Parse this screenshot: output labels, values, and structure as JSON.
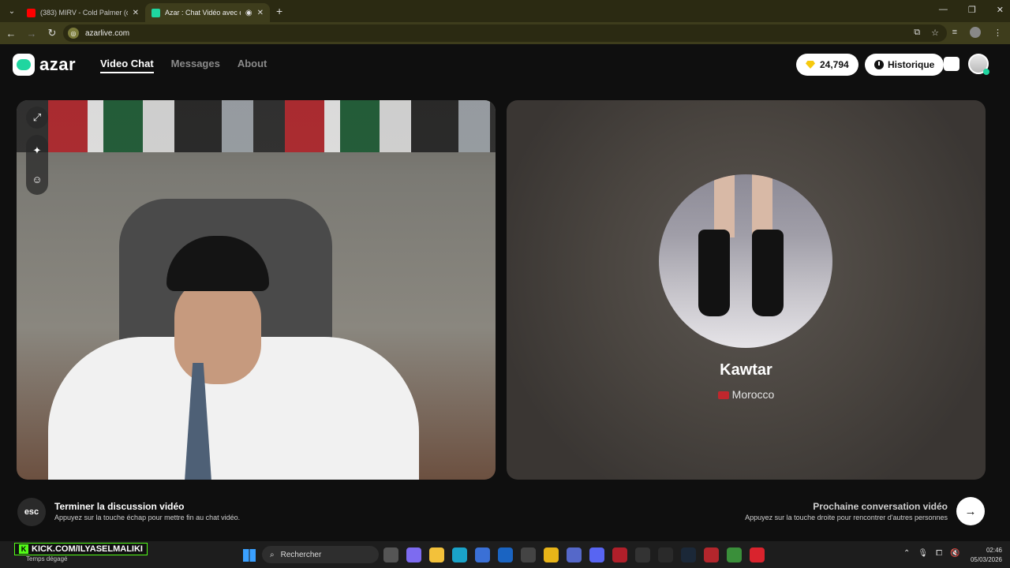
{
  "browser": {
    "tabs": [
      {
        "title": "(383) MIRV - Cold Palmer (offic",
        "favicon_color": "#ff0000",
        "active": false
      },
      {
        "title": "Azar : Chat Vidéo avec de",
        "favicon_color": "#1fd6a0",
        "active": true
      }
    ],
    "url": "azarlive.com"
  },
  "app": {
    "logo_text": "azar",
    "nav": [
      {
        "label": "Video Chat",
        "active": true
      },
      {
        "label": "Messages",
        "active": false
      },
      {
        "label": "About",
        "active": false
      }
    ],
    "gems": "24,794",
    "history_label": "Historique"
  },
  "remote": {
    "name": "Kawtar",
    "country": "Morocco"
  },
  "hints": {
    "esc_key": "esc",
    "end_title": "Terminer la discussion vidéo",
    "end_sub": "Appuyez sur la touche échap pour mettre fin au chat vidéo.",
    "next_title": "Prochaine conversation vidéo",
    "next_sub": "Appuyez sur la touche droite pour rencontrer d'autres personnes"
  },
  "taskbar": {
    "overlay_text": "KICK.COM/ILYASELMALIKI",
    "weather": "Temps dégagé",
    "search_placeholder": "Rechercher",
    "time": "02:46",
    "date": "05/03/2026"
  },
  "colors": {
    "brand": "#1fd6a0",
    "gem": "#f6c90e",
    "kick_green": "#53fc18"
  }
}
